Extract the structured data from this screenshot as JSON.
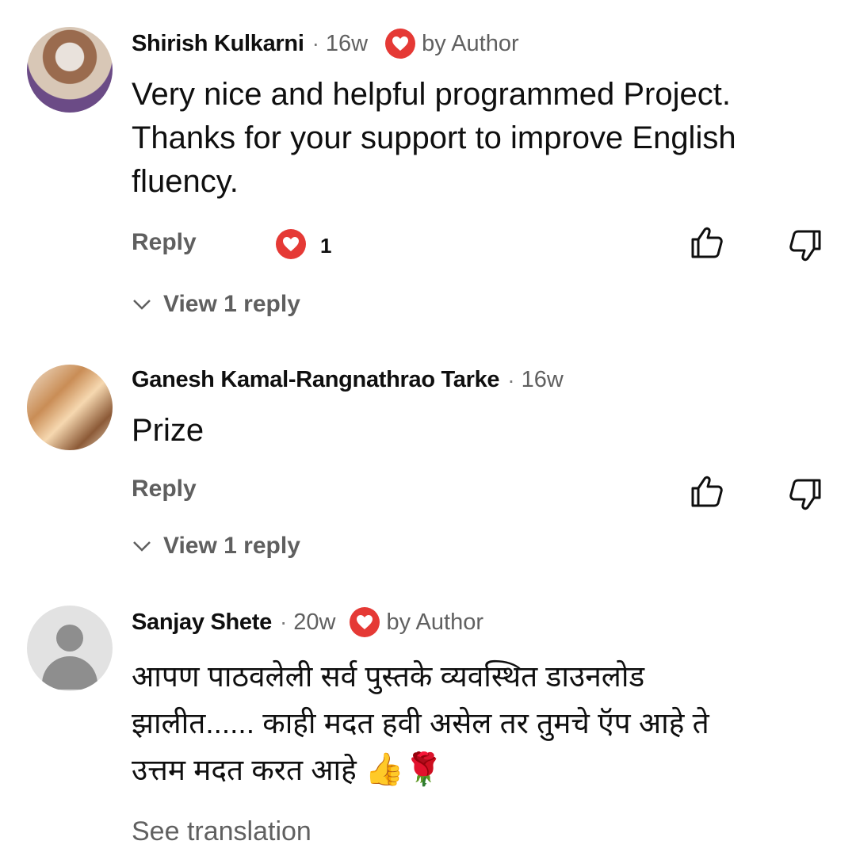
{
  "comments": [
    {
      "author": "Shirish Kulkarni",
      "time": "16w",
      "author_heart": "by Author",
      "text_lines": [
        "Very nice and helpful programmed Project.",
        "Thanks for your support to improve English",
        "fluency."
      ],
      "reply_label": "Reply",
      "heart_count": "1",
      "view_replies": "View 1 reply"
    },
    {
      "author": "Ganesh Kamal-Rangnathrao Tarke",
      "time": "16w",
      "text_lines": [
        "Prize"
      ],
      "reply_label": "Reply",
      "view_replies": "View 1 reply"
    },
    {
      "author": "Sanjay Shete",
      "time": "20w",
      "author_heart": "by Author",
      "text_lines": [
        "आपण पाठवलेली सर्व पुस्तके व्यवस्थित डाउनलोड",
        "झालीत...... काही मदत हवी असेल तर तुमचे ऍप आहे ते",
        "उत्तम मदत करत आहे"
      ],
      "emoji": "👍🌹",
      "see_translation": "See translation"
    }
  ],
  "colors": {
    "heart": "#e53935",
    "secondary_text": "#606060",
    "primary_text": "#0f0f0f"
  },
  "icons": [
    "heart-icon",
    "thumbs-up-icon",
    "thumbs-down-icon",
    "chevron-down-icon",
    "default-avatar-icon"
  ]
}
